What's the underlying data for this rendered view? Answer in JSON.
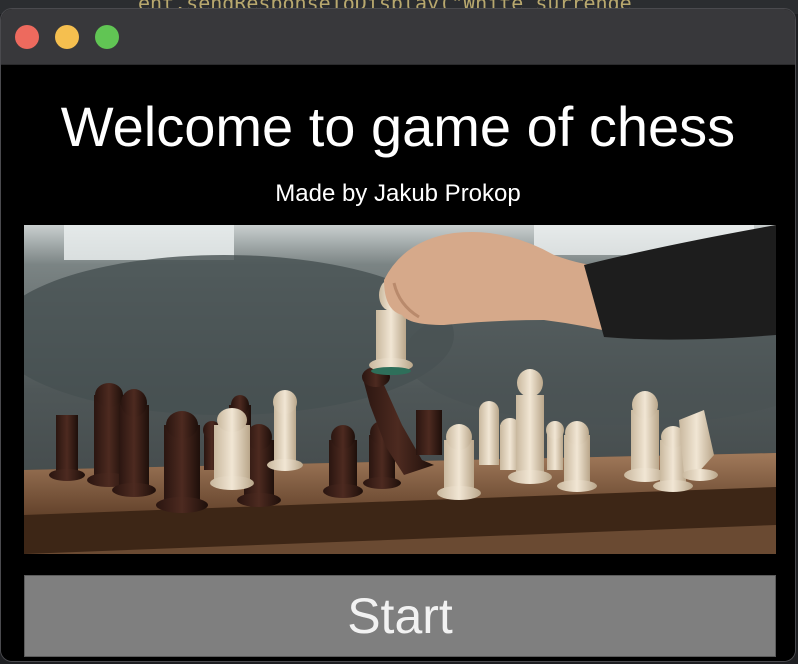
{
  "background_editor": {
    "code_fragment": "ent.sendResponseToDisplay(\"White surrende"
  },
  "window": {
    "title": "",
    "controls": [
      "close",
      "minimize",
      "maximize"
    ]
  },
  "main": {
    "heading": "Welcome to game of chess",
    "subheading": "Made by Jakub Prokop",
    "image_alt": "chess-board-photo",
    "start_button_label": "Start"
  },
  "colors": {
    "window_bg": "#000000",
    "titlebar_bg": "#38383b",
    "button_bg": "#7f7f7f",
    "close": "#ed6a5e",
    "minimize": "#f5bf4f",
    "maximize": "#61c554"
  }
}
